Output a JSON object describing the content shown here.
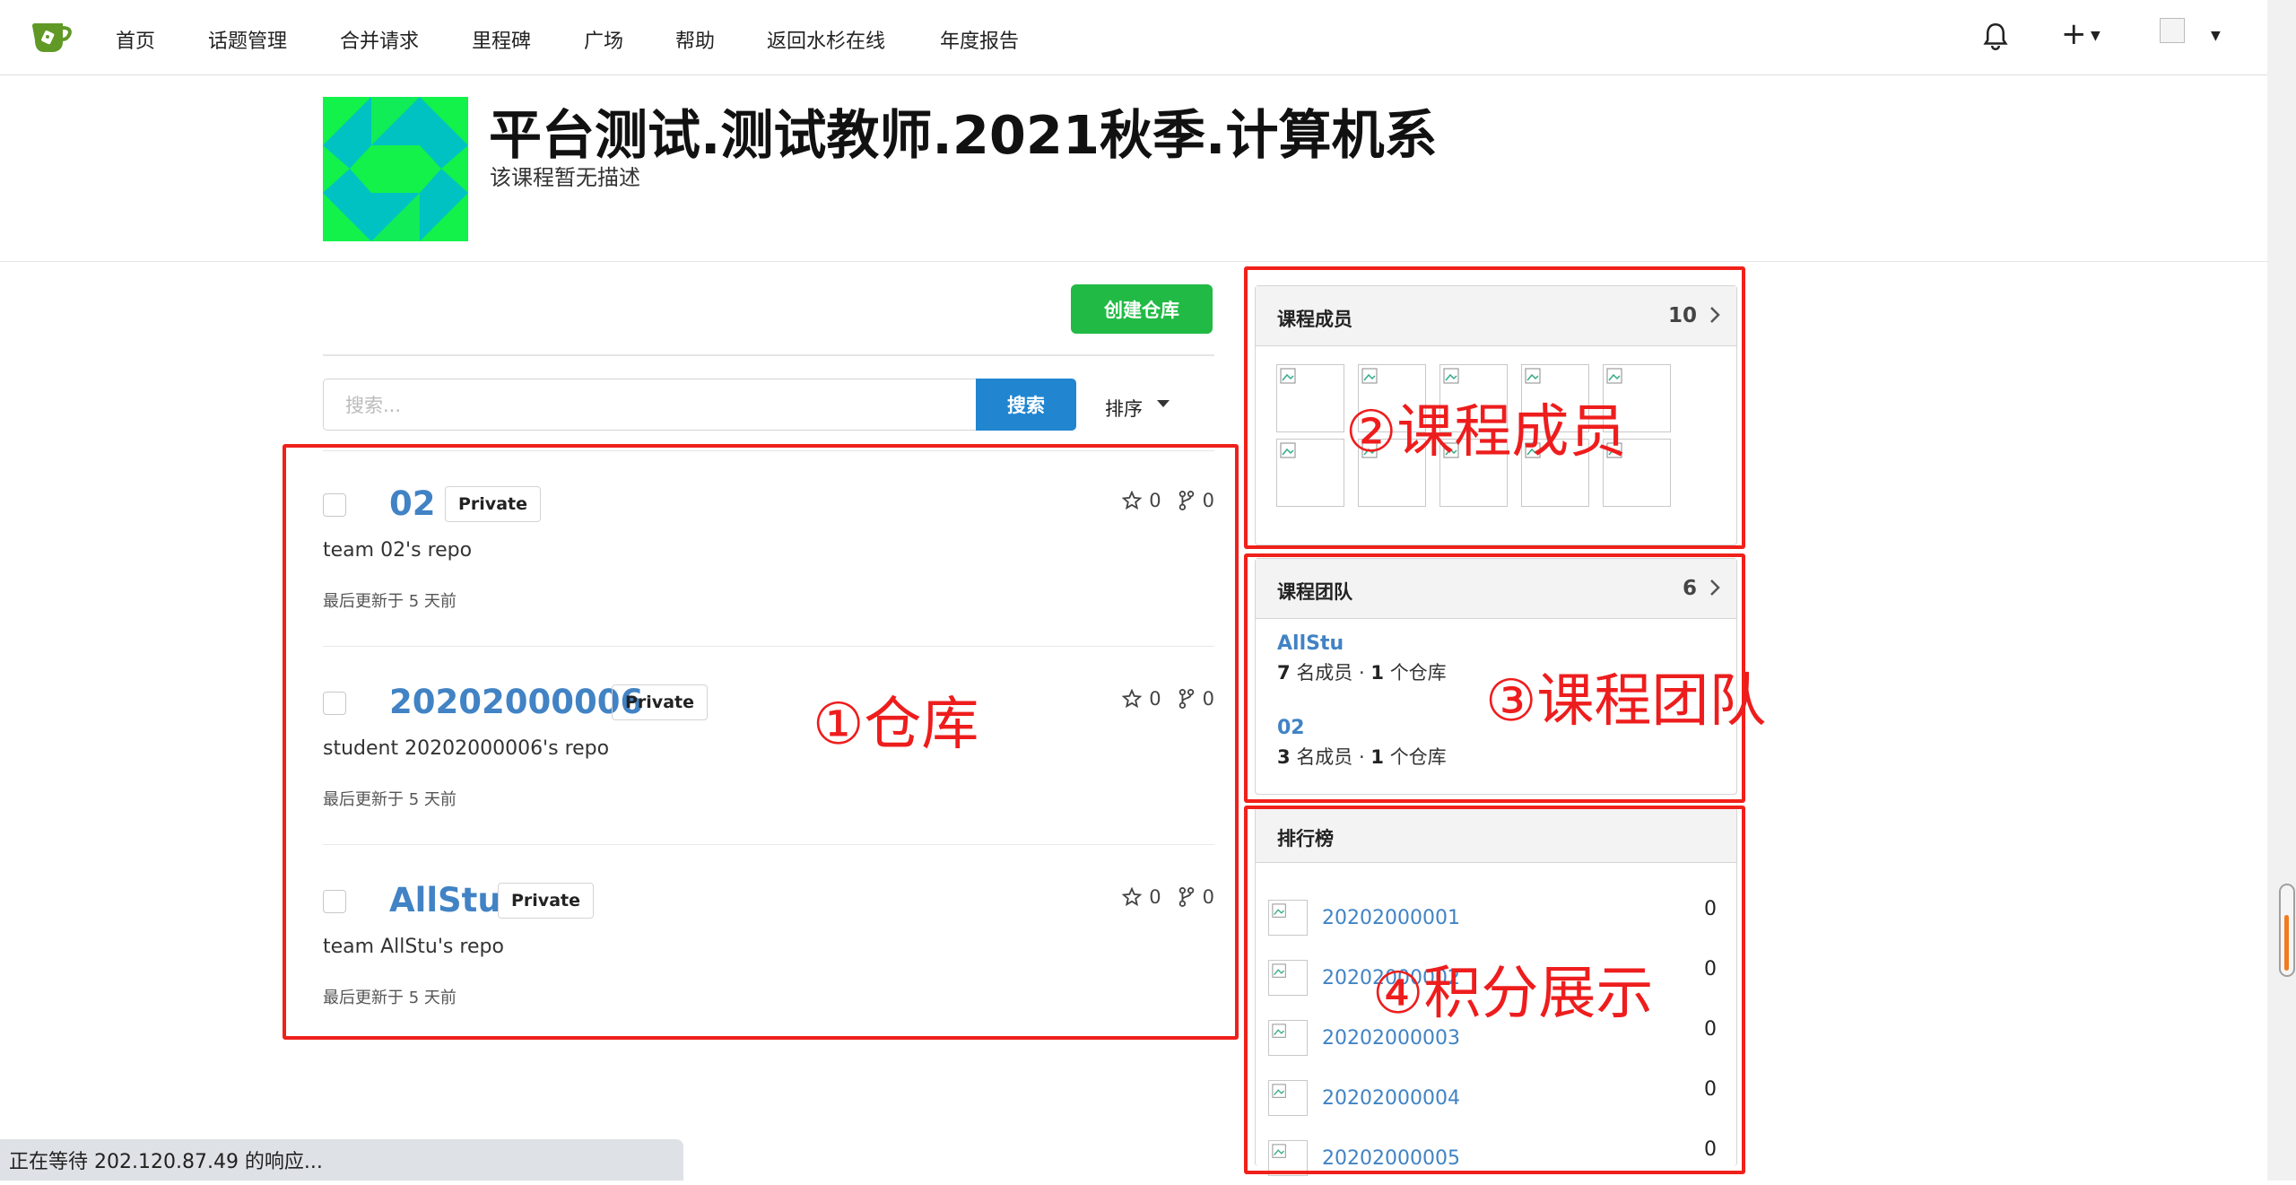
{
  "nav": {
    "items": [
      "首页",
      "话题管理",
      "合并请求",
      "里程碑",
      "广场",
      "帮助",
      "返回水杉在线",
      "年度报告"
    ],
    "plus": "+"
  },
  "org": {
    "title": "平台测试.测试教师.2021秋季.计算机系",
    "description": "该课程暂无描述"
  },
  "toolbar": {
    "create_repo": "创建仓库",
    "search_placeholder": "搜索...",
    "search_button": "搜索",
    "sort": "排序"
  },
  "repos": [
    {
      "name": "02",
      "visibility": "Private",
      "description": "team 02's repo",
      "updated": "最后更新于 5 天前",
      "stars": "0",
      "forks": "0"
    },
    {
      "name": "20202000006",
      "visibility": "Private",
      "description": "student 20202000006's repo",
      "updated": "最后更新于 5 天前",
      "stars": "0",
      "forks": "0"
    },
    {
      "name": "AllStu",
      "visibility": "Private",
      "description": "team AllStu's repo",
      "updated": "最后更新于 5 天前",
      "stars": "0",
      "forks": "0"
    }
  ],
  "members_card": {
    "title": "课程成员",
    "count": "10"
  },
  "teams_card": {
    "title": "课程团队",
    "count": "6",
    "teams": [
      {
        "name": "AllStu",
        "members": "7",
        "members_label": "名成员",
        "dot": "·",
        "repos": "1",
        "repos_label": "个仓库"
      },
      {
        "name": "02",
        "members": "3",
        "members_label": "名成员",
        "dot": "·",
        "repos": "1",
        "repos_label": "个仓库"
      }
    ]
  },
  "leaderboard": {
    "title": "排行榜",
    "rows": [
      {
        "user": "20202000001",
        "score": "0"
      },
      {
        "user": "20202000002",
        "score": "0"
      },
      {
        "user": "20202000003",
        "score": "0"
      },
      {
        "user": "20202000004",
        "score": "0"
      },
      {
        "user": "20202000005",
        "score": "0"
      }
    ]
  },
  "annotations": {
    "repos": "①仓库",
    "members": "②课程成员",
    "teams": "③课程团队",
    "points": "④积分展示"
  },
  "statusbar": "正在等待 202.120.87.49 的响应...",
  "colors": {
    "link": "#4183c4",
    "create_button": "#21ba45",
    "search_button": "#2185d0",
    "annotation": "#f0201a"
  }
}
